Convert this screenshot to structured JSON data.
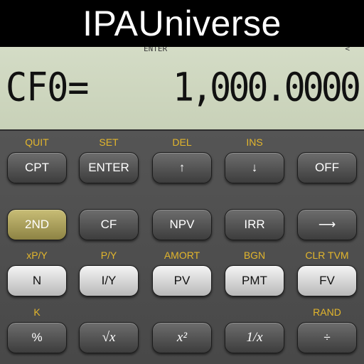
{
  "banner": {
    "title": "IPAUniverse"
  },
  "display": {
    "annunciator_left": "ENTER",
    "annunciator_right": "<",
    "label": "CF0=",
    "value": "1,000.0000"
  },
  "keypad": {
    "rows": [
      [
        {
          "secondary": "QUIT",
          "label": "CPT",
          "style": "dark"
        },
        {
          "secondary": "SET",
          "label": "ENTER",
          "style": "dark"
        },
        {
          "secondary": "DEL",
          "label": "↑",
          "style": "dark"
        },
        {
          "secondary": "INS",
          "label": "↓",
          "style": "dark"
        },
        {
          "secondary": "",
          "label": "OFF",
          "style": "dark"
        }
      ],
      [
        {
          "secondary": "",
          "label": "2ND",
          "style": "gold"
        },
        {
          "secondary": "",
          "label": "CF",
          "style": "dark"
        },
        {
          "secondary": "",
          "label": "NPV",
          "style": "dark"
        },
        {
          "secondary": "",
          "label": "IRR",
          "style": "dark"
        },
        {
          "secondary": "",
          "label": "⟶",
          "style": "dark"
        }
      ],
      [
        {
          "secondary": "xP/Y",
          "label": "N",
          "style": "light"
        },
        {
          "secondary": "P/Y",
          "label": "I/Y",
          "style": "light"
        },
        {
          "secondary": "AMORT",
          "label": "PV",
          "style": "light"
        },
        {
          "secondary": "BGN",
          "label": "PMT",
          "style": "light"
        },
        {
          "secondary": "CLR TVM",
          "label": "FV",
          "style": "light"
        }
      ],
      [
        {
          "secondary": "K",
          "label": "%",
          "style": "dark"
        },
        {
          "secondary": "",
          "label": "√x",
          "style": "dark"
        },
        {
          "secondary": "",
          "label": "x²",
          "style": "dark"
        },
        {
          "secondary": "",
          "label": "1/x",
          "style": "dark"
        },
        {
          "secondary": "RAND",
          "label": "÷",
          "style": "dark"
        }
      ]
    ]
  }
}
